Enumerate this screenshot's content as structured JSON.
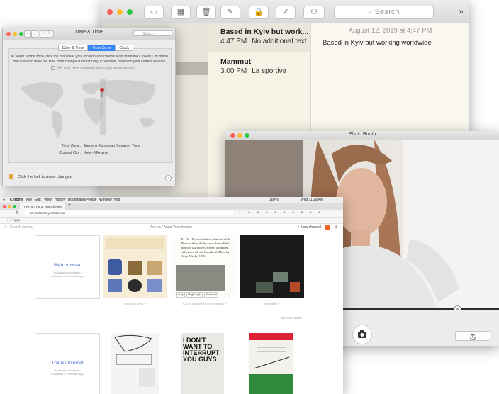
{
  "notes": {
    "search_placeholder": "Search",
    "items": [
      {
        "title": "Based in Kyiv but work...",
        "time": "4:47 PM",
        "snippet": "No additional text"
      },
      {
        "title": "Mammut",
        "time": "3:00 PM",
        "snippet": "La sportiva"
      }
    ],
    "date": "August 12, 2019 at 4:47 PM",
    "body": "Based in Kyiv but working worldwide"
  },
  "datetime": {
    "title": "Date & Time",
    "search_placeholder": "Search",
    "tabs": [
      "Date & Time",
      "Time Zone",
      "Clock"
    ],
    "active_tab": "Time Zone",
    "hint_line1": "To select a time zone, click the map near your location and choose a city from the Closest City menu.",
    "hint_line2": "You can also have the time zone change automatically, if possible, based on your current location.",
    "auto_label": "Set time zone automatically using current location",
    "time_zone_label": "Time Zone:",
    "time_zone_value": "Eastern European Summer Time",
    "closest_city_label": "Closest City:",
    "closest_city_value": "Kyiv - Ukraine",
    "lock_text": "Click the lock to make changes.",
    "help": "?"
  },
  "photobooth": {
    "title": "Photo Booth",
    "close": "×"
  },
  "chrome": {
    "menu": [
      "Chrome",
      "File",
      "Edit",
      "View",
      "History",
      "Bookmarks",
      "People",
      "Window",
      "Help"
    ],
    "clock": "Wed 11:28 AM",
    "battery": "100%",
    "tab_title": "Are.na / Anna Yushchenko",
    "url": "are.na/anna-yushchenko",
    "bookmarks": "Apps",
    "arena_search": "Search Are.na",
    "arena_path": "Are.na / Anna Yushchenko",
    "new_channel": "+ New channel",
    "blocks": [
      {
        "title": "Web browser",
        "by": "by Anna Yushchenko",
        "meta": "81 blocks • 2 minutes ago"
      },
      {
        "title": "Thanks Internet",
        "by": "by Anna Yushchenko",
        "meta": "81 blocks • 2 minutes ago"
      }
    ],
    "captions": [
      "Bread on Earth ↗",
      "F-A-M, a collection of movie stills ↗",
      "Imprimeria ↗"
    ],
    "more": "+86 more blocks",
    "movie_text": "F—A—M, a collection of movie stills. Browse the stills by color date-added director tag movie. Here is a random still, from All the President's Men, by Alan Pakula, 1976.",
    "movie_tags": [
      "#city",
      "#high-angle",
      "#transport"
    ],
    "poster_text": "I DON'T WANT TO INTERRUPT YOU GUYS"
  }
}
